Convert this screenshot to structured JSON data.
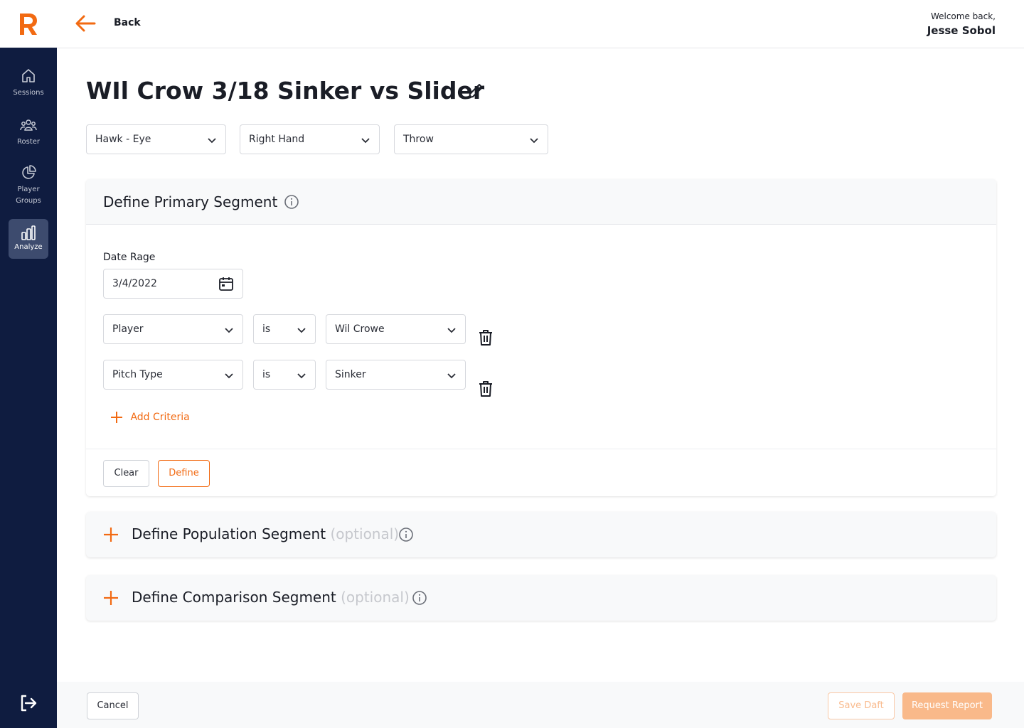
{
  "header": {
    "back_label": "Back",
    "welcome_text": "Welcome back,",
    "user_name": "Jesse Sobol"
  },
  "sidebar": {
    "items": [
      {
        "label": "Sessions",
        "icon": "home-icon",
        "active": false
      },
      {
        "label": "Roster",
        "icon": "people-icon",
        "active": false
      },
      {
        "label": "Player Groups",
        "icon": "pie-chart-icon",
        "active": false
      },
      {
        "label": "Analyze",
        "icon": "bar-chart-icon",
        "active": true
      }
    ]
  },
  "page": {
    "title": "WIl Crow 3/18 Sinker vs Slider"
  },
  "filters": {
    "source": "Hawk - Eye",
    "hand": "Right Hand",
    "action": "Throw"
  },
  "primary_segment": {
    "title": "Define Primary Segment",
    "date_label": "Date Rage",
    "date_value": "3/4/2022",
    "criteria": [
      {
        "field": "Player",
        "operator": "is",
        "value": "Wil Crowe"
      },
      {
        "field": "Pitch Type",
        "operator": "is",
        "value": "Sinker"
      }
    ],
    "add_criteria_label": "Add Criteria",
    "clear_label": "Clear",
    "define_label": "Define"
  },
  "population_segment": {
    "title": "Define Population Segment",
    "optional": "(optional)"
  },
  "comparison_segment": {
    "title": "Define Comparison Segment",
    "optional": "(optional)"
  },
  "footer": {
    "cancel_label": "Cancel",
    "save_draft_label": "Save Daft",
    "request_report_label": "Request Report"
  },
  "colors": {
    "accent": "#f26a12",
    "sidebar": "#0f1c40",
    "sidebar_active": "#3d4b6e"
  }
}
